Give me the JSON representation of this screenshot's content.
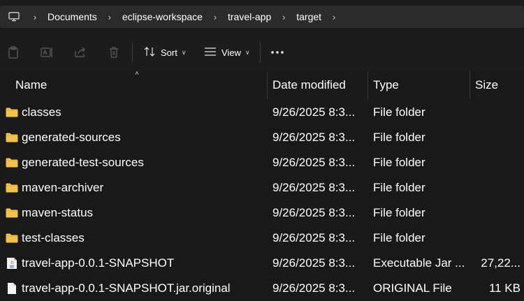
{
  "address_bar": {
    "icon": "computer-icon",
    "breadcrumbs": [
      "Documents",
      "eclipse-workspace",
      "travel-app",
      "target"
    ]
  },
  "toolbar": {
    "sort_label": "Sort",
    "view_label": "View",
    "icons": [
      "paste-icon",
      "rename-icon",
      "share-icon",
      "delete-icon",
      "more-icon"
    ]
  },
  "columns": {
    "name": "Name",
    "date": "Date modified",
    "type": "Type",
    "size": "Size"
  },
  "files": [
    {
      "name": "classes",
      "date": "9/26/2025 8:3...",
      "type": "File folder",
      "size": "",
      "icon": "folder-icon"
    },
    {
      "name": "generated-sources",
      "date": "9/26/2025 8:3...",
      "type": "File folder",
      "size": "",
      "icon": "folder-icon"
    },
    {
      "name": "generated-test-sources",
      "date": "9/26/2025 8:3...",
      "type": "File folder",
      "size": "",
      "icon": "folder-icon"
    },
    {
      "name": "maven-archiver",
      "date": "9/26/2025 8:3...",
      "type": "File folder",
      "size": "",
      "icon": "folder-icon"
    },
    {
      "name": "maven-status",
      "date": "9/26/2025 8:3...",
      "type": "File folder",
      "size": "",
      "icon": "folder-icon"
    },
    {
      "name": "test-classes",
      "date": "9/26/2025 8:3...",
      "type": "File folder",
      "size": "",
      "icon": "folder-icon"
    },
    {
      "name": "travel-app-0.0.1-SNAPSHOT",
      "date": "9/26/2025 8:3...",
      "type": "Executable Jar ...",
      "size": "27,22...",
      "icon": "jar-file-icon"
    },
    {
      "name": "travel-app-0.0.1-SNAPSHOT.jar.original",
      "date": "9/26/2025 8:3...",
      "type": "ORIGINAL File",
      "size": "11 KB",
      "icon": "file-icon"
    }
  ],
  "colors": {
    "background": "#191919",
    "toolbar_background": "#1c1c1c",
    "address_background": "#2b2b2b",
    "folder_yellow": "#f4c04e",
    "text": "#ffffff"
  }
}
